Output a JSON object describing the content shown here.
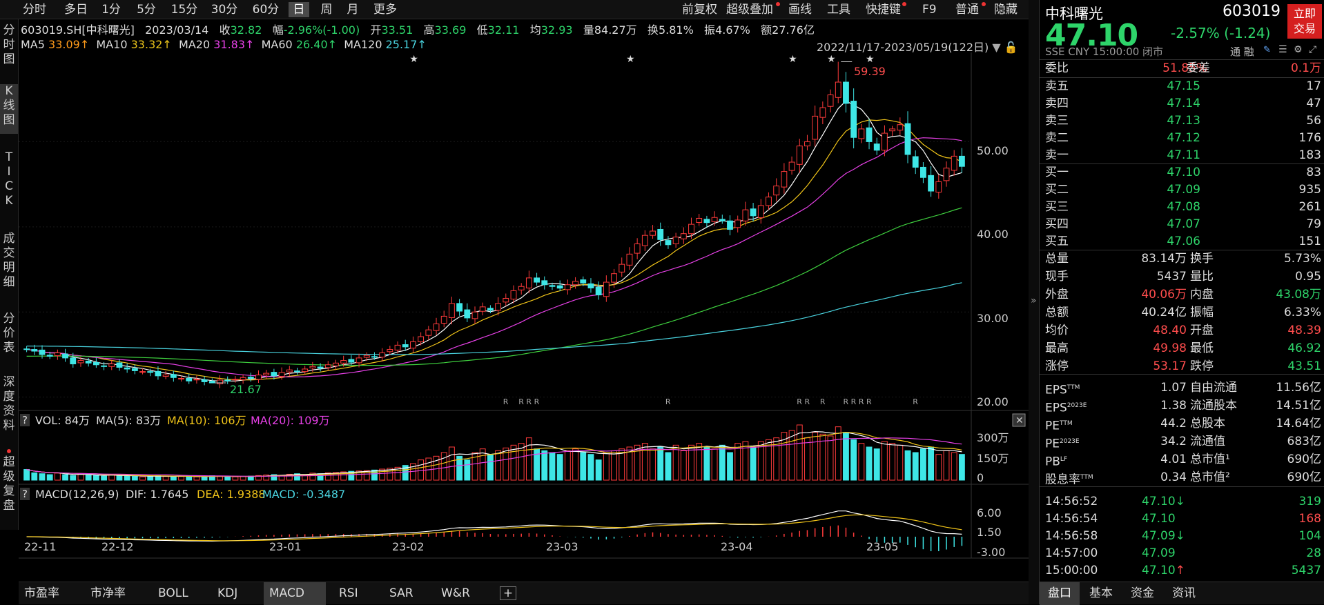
{
  "toolbar": {
    "tabs": [
      "分时",
      "多日",
      "1分",
      "5分",
      "15分",
      "30分",
      "60分",
      "日",
      "周",
      "月",
      "更多"
    ],
    "right": [
      "前复权",
      "超级叠加",
      "画线",
      "工具",
      "快捷键",
      "F9",
      "普通",
      "隐藏"
    ]
  },
  "sidebar": {
    "tabs": [
      "分\n时\n图",
      "K\n线\n图",
      "T\nI\nC\nK",
      "成\n交\n明\n细",
      "分\n价\n表",
      "深\n度\n资\n料",
      "超\n级\n复\n盘"
    ]
  },
  "infobar": {
    "code": "603019.SH[中科曙光]",
    "date": "2023/03/14",
    "close_label": "收",
    "close": "32.82",
    "range_label": "幅",
    "range": "-2.96%(-1.00)",
    "open_label": "开",
    "open": "33.51",
    "high_label": "高",
    "high": "33.69",
    "low_label": "低",
    "low": "32.11",
    "avg_label": "均",
    "avg": "32.93",
    "vol_label": "量",
    "vol": "84.27万",
    "turn_label": "换",
    "turn": "5.81%",
    "amp_label": "振",
    "amp": "4.67%",
    "amt_label": "额",
    "amt": "27.76亿"
  },
  "ma": {
    "ma5": "MA5",
    "ma5v": "33.09↑",
    "ma10": "MA10",
    "ma10v": "33.32↑",
    "ma20": "MA20",
    "ma20v": "31.83↑",
    "ma60": "MA60",
    "ma60v": "26.40↑",
    "ma120": "MA120",
    "ma120v": "25.17↑",
    "period": "2022/11/17-2023/05/19(122日)"
  },
  "price_axis": [
    "50.00",
    "40.00",
    "30.00",
    "20.00"
  ],
  "annot": {
    "high": "59.39",
    "low": "21.67"
  },
  "vol": {
    "q": "?",
    "title": "VOL: 84万",
    "ma5": "MA(5): 83万",
    "ma10": "MA(10): 106万",
    "ma20": "MA(20): 109万",
    "axis": [
      "300万",
      "150万",
      "0"
    ]
  },
  "macd": {
    "q": "?",
    "title": "MACD(12,26,9)",
    "dif": "DIF: 1.7645",
    "dea": "DEA: 1.9388",
    "macd": "MACD: -0.3487",
    "axis": [
      "6.00",
      "1.50",
      "-3.00"
    ]
  },
  "xaxis": [
    "22-11",
    "22-12",
    "23-01",
    "23-02",
    "23-03",
    "23-04",
    "23-05"
  ],
  "bottom_tabs": [
    "市盈率",
    "市净率",
    "BOLL",
    "KDJ",
    "MACD",
    "RSI",
    "SAR",
    "W&R",
    "+"
  ],
  "colors": {
    "up": "#ff3b3b",
    "down": "#3ee6e6",
    "ma5": "#ffffff",
    "ma10": "#f0c419",
    "ma20": "#e640e6",
    "ma60": "#3ecf3e",
    "ma120": "#4ad4e0"
  },
  "quote": {
    "name": "中科曙光",
    "code": "603019",
    "price": "47.10",
    "change": "-2.57% (-1.24)",
    "exch": "SSE  CNY  15:00:00  闭市",
    "tags": "通  融",
    "trade_btn": "立即\n交易",
    "weibi_label": "委比",
    "weibi": "51.85%",
    "weicha_label": "委差",
    "weicha": "0.1万",
    "asks": [
      {
        "l": "卖五",
        "p": "47.15",
        "v": "17"
      },
      {
        "l": "卖四",
        "p": "47.14",
        "v": "47"
      },
      {
        "l": "卖三",
        "p": "47.13",
        "v": "56"
      },
      {
        "l": "卖二",
        "p": "47.12",
        "v": "176"
      },
      {
        "l": "卖一",
        "p": "47.11",
        "v": "183"
      }
    ],
    "bids": [
      {
        "l": "买一",
        "p": "47.10",
        "v": "83"
      },
      {
        "l": "买二",
        "p": "47.09",
        "v": "935"
      },
      {
        "l": "买三",
        "p": "47.08",
        "v": "261"
      },
      {
        "l": "买四",
        "p": "47.07",
        "v": "79"
      },
      {
        "l": "买五",
        "p": "47.06",
        "v": "151"
      }
    ],
    "stats": [
      {
        "a": "总量",
        "av": "83.14万",
        "b": "换手",
        "bv": "5.73%",
        "ac": "w",
        "bc": "w"
      },
      {
        "a": "现手",
        "av": "5437",
        "b": "量比",
        "bv": "0.95",
        "ac": "w",
        "bc": "w"
      },
      {
        "a": "外盘",
        "av": "40.06万",
        "b": "内盘",
        "bv": "43.08万",
        "ac": "r",
        "bc": "g"
      },
      {
        "a": "总额",
        "av": "40.24亿",
        "b": "振幅",
        "bv": "6.33%",
        "ac": "w",
        "bc": "w"
      },
      {
        "a": "均价",
        "av": "48.40",
        "b": "开盘",
        "bv": "48.39",
        "ac": "r",
        "bc": "r"
      },
      {
        "a": "最高",
        "av": "49.98",
        "b": "最低",
        "bv": "46.92",
        "ac": "r",
        "bc": "g"
      },
      {
        "a": "涨停",
        "av": "53.17",
        "b": "跌停",
        "bv": "43.51",
        "ac": "r",
        "bc": "g"
      }
    ],
    "fund": [
      {
        "a": "EPS",
        "as": "TTM",
        "av": "1.07",
        "b": "自由流通",
        "bv": "11.56亿"
      },
      {
        "a": "EPS",
        "as": "2023E",
        "av": "1.38",
        "b": "流通股本",
        "bv": "14.51亿"
      },
      {
        "a": "PE",
        "as": "TTM",
        "av": "44.2",
        "b": "总股本",
        "bv": "14.64亿"
      },
      {
        "a": "PE",
        "as": "2023E",
        "av": "34.2",
        "b": "流通值",
        "bv": "683亿"
      },
      {
        "a": "PB",
        "as": "LF",
        "av": "4.01",
        "b": "总市值¹",
        "bv": "690亿"
      },
      {
        "a": "股息率",
        "as": "TTM",
        "av": "0.34",
        "b": "总市值²",
        "bv": "690亿"
      }
    ],
    "ticks": [
      {
        "t": "14:56:52",
        "p": "47.10",
        "d": "down",
        "v": "319",
        "vc": "g"
      },
      {
        "t": "14:56:54",
        "p": "47.10",
        "d": "",
        "v": "168",
        "vc": "r"
      },
      {
        "t": "14:56:58",
        "p": "47.09",
        "d": "down",
        "v": "104",
        "vc": "g"
      },
      {
        "t": "14:57:00",
        "p": "47.09",
        "d": "",
        "v": "28",
        "vc": "g"
      },
      {
        "t": "15:00:00",
        "p": "47.10",
        "d": "up",
        "v": "5437",
        "vc": "g"
      }
    ],
    "bottom_tabs": [
      "盘口",
      "基本",
      "资金",
      "资讯"
    ]
  },
  "chart_data": {
    "type": "candlestick",
    "x_start": "2022/11/17",
    "x_end": "2023/05/19",
    "n": 122,
    "ylim": [
      19,
      60
    ],
    "closes": [
      25.6,
      25.4,
      25.0,
      24.8,
      25.2,
      24.6,
      23.9,
      24.3,
      24.0,
      23.8,
      23.6,
      23.9,
      23.5,
      23.3,
      23.1,
      23.0,
      22.9,
      22.5,
      22.6,
      22.3,
      22.2,
      21.9,
      22.1,
      21.8,
      21.67,
      22.0,
      21.9,
      22.1,
      22.3,
      22.2,
      22.6,
      22.8,
      22.5,
      22.9,
      23.2,
      23.0,
      23.3,
      23.6,
      23.4,
      23.8,
      24.0,
      24.3,
      24.1,
      24.6,
      24.9,
      24.7,
      25.2,
      25.6,
      26.1,
      25.9,
      26.5,
      27.1,
      27.9,
      28.6,
      29.5,
      31.0,
      30.1,
      29.3,
      30.0,
      30.6,
      30.2,
      31.0,
      31.6,
      32.5,
      33.0,
      34.0,
      33.5,
      33.2,
      33.0,
      32.8,
      33.2,
      33.6,
      33.4,
      32.82,
      32.0,
      33.5,
      34.5,
      35.6,
      36.8,
      38.0,
      39.0,
      39.5,
      38.5,
      37.9,
      38.8,
      39.2,
      40.3,
      41.0,
      40.5,
      41.1,
      40.7,
      39.7,
      40.8,
      42.0,
      41.3,
      42.5,
      43.5,
      44.8,
      46.5,
      47.6,
      49.5,
      50.0,
      53.0,
      54.0,
      55.5,
      57.0,
      54.5,
      50.5,
      51.5,
      50.0,
      49.0,
      51.0,
      51.5,
      52.0,
      48.5,
      47.0,
      45.8,
      44.2,
      45.3,
      46.9,
      48.3,
      47.1
    ],
    "volumes": [
      58,
      40,
      35,
      30,
      38,
      30,
      25,
      32,
      28,
      25,
      22,
      30,
      24,
      22,
      20,
      18,
      22,
      25,
      20,
      18,
      20,
      22,
      18,
      20,
      24,
      20,
      22,
      18,
      20,
      22,
      25,
      28,
      30,
      26,
      32,
      35,
      30,
      38,
      35,
      40,
      42,
      45,
      48,
      50,
      52,
      55,
      60,
      65,
      70,
      80,
      90,
      110,
      120,
      130,
      150,
      180,
      130,
      110,
      150,
      170,
      140,
      160,
      175,
      190,
      200,
      230,
      170,
      160,
      150,
      140,
      160,
      170,
      150,
      140,
      110,
      150,
      160,
      170,
      180,
      190,
      200,
      170,
      180,
      150,
      190,
      160,
      190,
      200,
      180,
      170,
      190,
      150,
      200,
      210,
      180,
      210,
      220,
      230,
      260,
      270,
      300,
      230,
      260,
      250,
      240,
      290,
      260,
      220,
      200,
      180,
      170,
      210,
      200,
      190,
      160,
      150,
      170,
      180,
      140,
      160,
      150,
      140
    ],
    "high_annot": "59.39",
    "low_annot": "21.67"
  }
}
